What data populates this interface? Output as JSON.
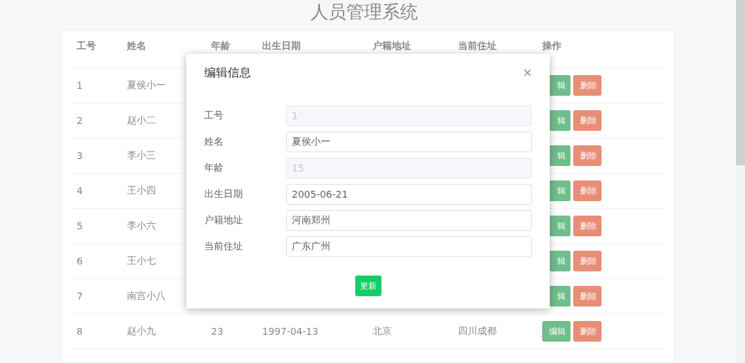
{
  "page": {
    "title": "人员管理系统"
  },
  "table": {
    "columns": [
      "工号",
      "姓名",
      "年龄",
      "出生日期",
      "户籍地址",
      "当前住址",
      "操作"
    ],
    "rows": [
      {
        "cells": [
          "1",
          "夏侯小一"
        ],
        "actions": [
          "辑",
          "删除"
        ]
      },
      {
        "cells": [
          "2",
          "赵小二"
        ],
        "actions": [
          "辑",
          "删除"
        ]
      },
      {
        "cells": [
          "3",
          "李小三"
        ],
        "actions": [
          "辑",
          "删除"
        ]
      },
      {
        "cells": [
          "4",
          "王小四"
        ],
        "actions": [
          "辑",
          "删除"
        ]
      },
      {
        "cells": [
          "5",
          "李小六"
        ],
        "actions": [
          "辑",
          "删除"
        ]
      },
      {
        "cells": [
          "6",
          "王小七"
        ],
        "actions": [
          "辑",
          "删除"
        ]
      },
      {
        "cells": [
          "7",
          "南宫小八"
        ],
        "actions": [
          "辑",
          "删除"
        ]
      },
      {
        "cells": [
          "8",
          "赵小九",
          "23",
          "1997-04-13",
          "北京",
          "四川成都"
        ],
        "actions": [
          "编辑",
          "删除"
        ]
      }
    ]
  },
  "dialog": {
    "title": "编辑信息",
    "close": "×",
    "fields": [
      {
        "label": "工号",
        "value": "1",
        "disabled": true
      },
      {
        "label": "姓名",
        "value": "夏侯小一",
        "disabled": false
      },
      {
        "label": "年龄",
        "value": "15",
        "disabled": true
      },
      {
        "label": "出生日期",
        "value": "2005-06-21",
        "disabled": false
      },
      {
        "label": "户籍地址",
        "value": "河南郑州",
        "disabled": false
      },
      {
        "label": "当前住址",
        "value": "广东广州",
        "disabled": false
      }
    ],
    "submit": "更新"
  }
}
